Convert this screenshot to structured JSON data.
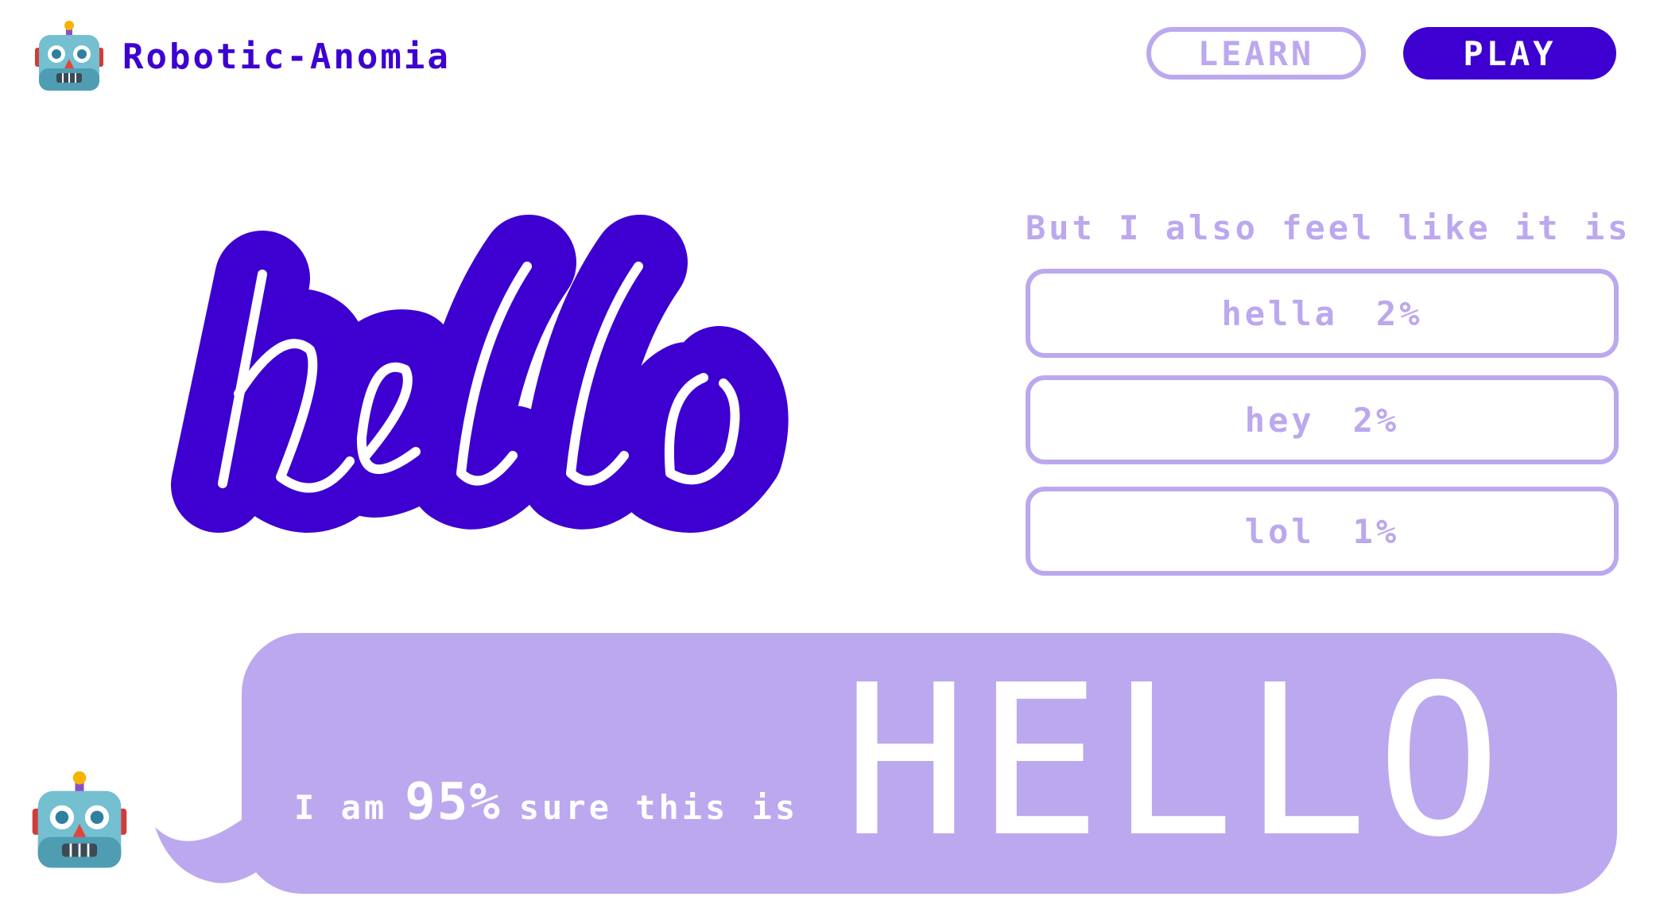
{
  "header": {
    "brand_icon": "robot-icon",
    "brand_title": "Robotic-Anomia",
    "learn_label": "LEARN",
    "play_label": "PLAY"
  },
  "drawing": {
    "text": "hello",
    "fill_color": "#3d00d1",
    "stroke_color": "#ffffff"
  },
  "alternatives": {
    "heading": "But I also feel like it is",
    "items": [
      {
        "word": "hella",
        "percent": "2%"
      },
      {
        "word": "hey",
        "percent": "2%"
      },
      {
        "word": "lol",
        "percent": "1%"
      }
    ]
  },
  "prediction": {
    "prefix": "I am",
    "percent": "95%",
    "suffix": "sure this is",
    "word": "HELLO"
  },
  "colors": {
    "primary": "#3d00d1",
    "light": "#bca8ee",
    "background": "#ffffff"
  }
}
